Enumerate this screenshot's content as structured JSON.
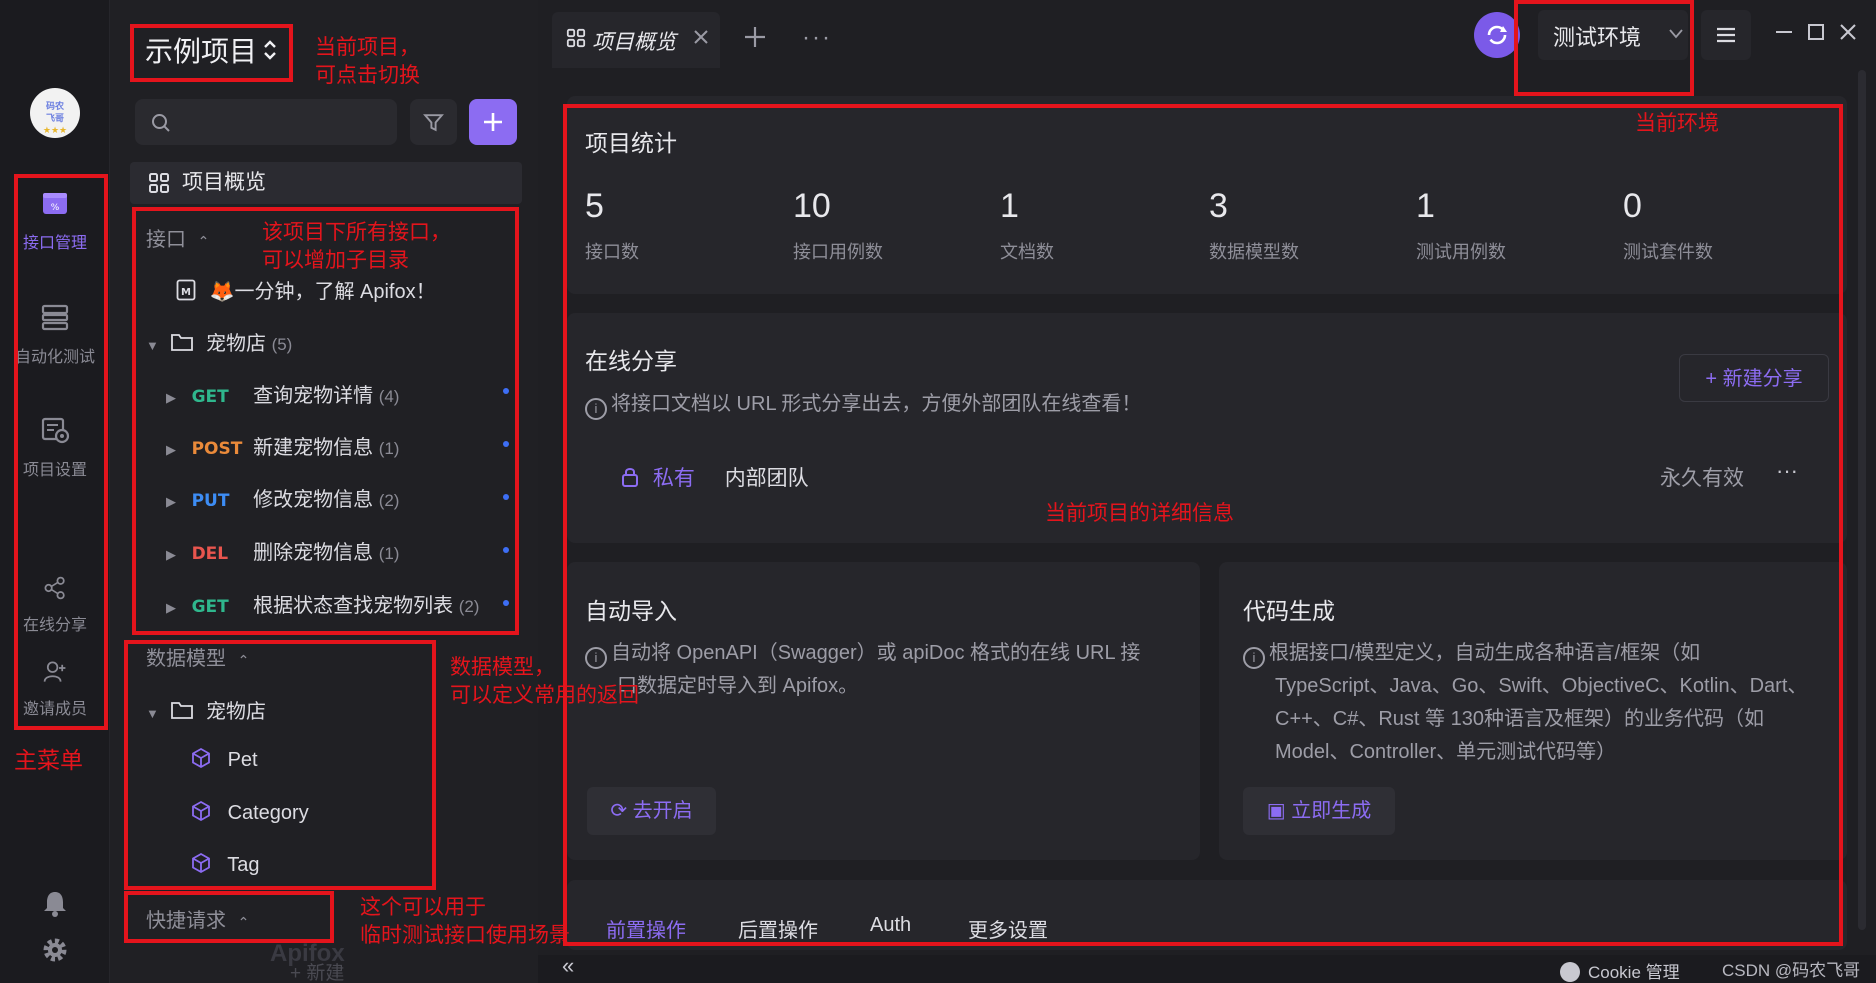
{
  "rail": {
    "avatar_text": [
      "码农",
      "飞哥",
      "★★★"
    ],
    "items": [
      {
        "label": "接口管理",
        "icon": "api-icon",
        "active": true
      },
      {
        "label": "自动化测试",
        "icon": "autotest-icon",
        "active": false
      },
      {
        "label": "项目设置",
        "icon": "project-settings-icon",
        "active": false
      },
      {
        "label": "在线分享",
        "icon": "share-icon",
        "active": false
      },
      {
        "label": "邀请成员",
        "icon": "invite-member-icon",
        "active": false
      }
    ]
  },
  "sidebar": {
    "project_name": "示例项目",
    "overview_label": "项目概览",
    "api_section_label": "接口",
    "intro_doc": "🦊一分钟，了解 Apifox！",
    "pet_folder": {
      "name": "宠物店",
      "count": "(5)"
    },
    "endpoints": [
      {
        "method": "GET",
        "name": "查询宠物详情",
        "count": "(4)"
      },
      {
        "method": "POST",
        "name": "新建宠物信息",
        "count": "(1)"
      },
      {
        "method": "PUT",
        "name": "修改宠物信息",
        "count": "(2)"
      },
      {
        "method": "DEL",
        "name": "删除宠物信息",
        "count": "(1)"
      },
      {
        "method": "GET",
        "name": "根据状态查找宠物列表",
        "count": "(2)"
      }
    ],
    "model_section_label": "数据模型",
    "model_folder": "宠物店",
    "models": [
      "Pet",
      "Category",
      "Tag"
    ],
    "quick_request_label": "快捷请求",
    "new_label": "新建",
    "watermark": "Apifox"
  },
  "tabs": {
    "active_tab": "项目概览",
    "env_name": "测试环境"
  },
  "stats": {
    "title": "项目统计",
    "items": [
      {
        "value": "5",
        "label": "接口数"
      },
      {
        "value": "10",
        "label": "接口用例数"
      },
      {
        "value": "1",
        "label": "文档数"
      },
      {
        "value": "3",
        "label": "数据模型数"
      },
      {
        "value": "1",
        "label": "测试用例数"
      },
      {
        "value": "0",
        "label": "测试套件数"
      }
    ]
  },
  "share": {
    "title": "在线分享",
    "new_button": "+ 新建分享",
    "description": "将接口文档以 URL 形式分享出去，方便外部团队在线查看！",
    "row": {
      "visibility": "私有",
      "team": "内部团队",
      "validity": "永久有效"
    }
  },
  "auto_import": {
    "title": "自动导入",
    "description": "自动将 OpenAPI（Swagger）或 apiDoc 格式的在线 URL 接口数据定时导入到 Apifox。",
    "line1": "自动将 OpenAPI（Swagger）或 apiDoc 格式的在线 URL 接",
    "line2": "口数据定时导入到 Apifox。",
    "button": "去开启"
  },
  "codegen": {
    "title": "代码生成",
    "line1": "根据接口/模型定义，自动生成各种语言/框架（如",
    "line2": "TypeScript、Java、Go、Swift、ObjectiveC、Kotlin、Dart、",
    "line3": "C++、C#、Rust 等 130种语言及框架）的业务代码（如",
    "line4": "Model、Controller、单元测试代码等）",
    "button": "立即生成"
  },
  "settings_tabs": [
    "前置操作",
    "后置操作",
    "Auth",
    "更多设置"
  ],
  "bottom": {
    "cookie": "Cookie 管理",
    "csdn": "CSDN @码农飞哥"
  },
  "annotations": {
    "project_switch": [
      "当前项目，",
      "可点击切换"
    ],
    "api_list": [
      "该项目下所有接口，",
      "可以增加子目录"
    ],
    "data_model": [
      "数据模型，",
      "可以定义常用的返回"
    ],
    "quick_request": [
      "这个可以用于",
      "临时测试接口使用场景"
    ],
    "main_menu": "主菜单",
    "current_env": "当前环境",
    "project_detail": "当前项目的详细信息"
  },
  "colors": {
    "accent": "#8c6cf2",
    "annotation_red": "#e4141c",
    "get": "#2fb78d",
    "post": "#ea8a3a",
    "put": "#3d8df5",
    "del": "#e8554e"
  }
}
